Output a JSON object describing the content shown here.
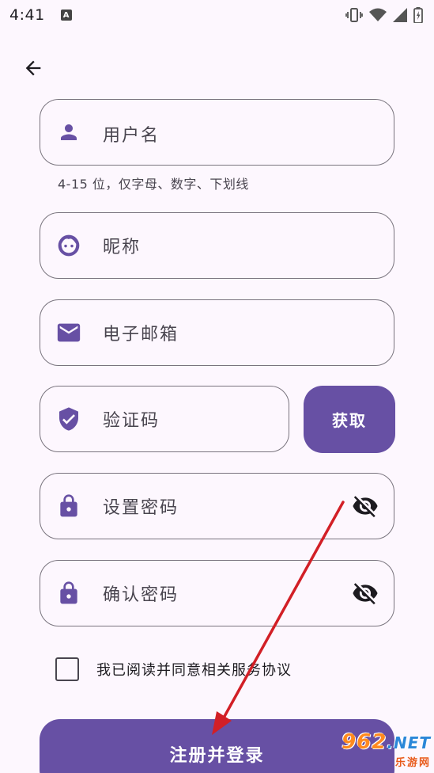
{
  "status_bar": {
    "time": "4:41",
    "badge": "A",
    "icons": [
      "vibrate-icon",
      "wifi-icon",
      "signal-icon",
      "battery-icon"
    ]
  },
  "header": {
    "back_icon": "arrow-left-icon"
  },
  "form": {
    "username": {
      "label": "用户名",
      "icon": "person-icon",
      "helper": "4-15 位，仅字母、数字、下划线"
    },
    "nickname": {
      "label": "昵称",
      "icon": "face-icon"
    },
    "email": {
      "label": "电子邮箱",
      "icon": "mail-icon"
    },
    "code": {
      "label": "验证码",
      "icon": "shield-icon",
      "button_label": "获取"
    },
    "password": {
      "label": "设置密码",
      "icon": "lock-icon",
      "toggle_icon": "eye-off-icon"
    },
    "confirm_password": {
      "label": "确认密码",
      "icon": "lock-icon",
      "toggle_icon": "eye-off-icon"
    },
    "agreement": {
      "label": "我已阅读并同意相关服务协议",
      "checked": false
    },
    "submit_label": "注册并登录"
  },
  "watermark": {
    "top": "962",
    "top_suffix": ".NET",
    "bottom": "乐游网"
  },
  "colors": {
    "background": "#fdf7fe",
    "primary": "#6750a4",
    "outline": "#79747e",
    "annotation_arrow": "#d21f26"
  }
}
